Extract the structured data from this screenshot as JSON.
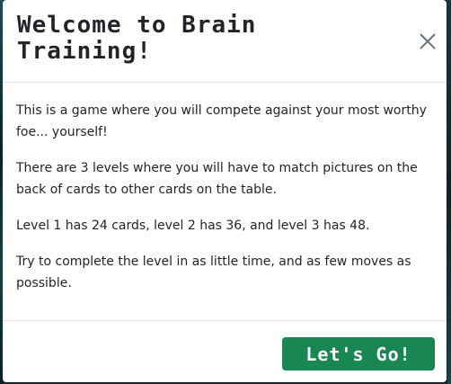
{
  "modal": {
    "title": "Welcome to Brain Training!",
    "close_icon": "close-icon",
    "paragraphs": [
      "This is a game where you will compete against your most worthy foe... yourself!",
      "There are 3 levels where you will have to match pictures on the back of cards to other cards on the table.",
      "Level 1 has 24 cards, level 2 has 36, and level 3 has 48.",
      "Try to complete the level in as little time, and as few moves as possible."
    ],
    "start_button_label": "Let's Go!"
  },
  "colors": {
    "button_green": "#198754",
    "text": "#212529",
    "divider": "#dee2e6",
    "close_icon": "#6c757d"
  }
}
